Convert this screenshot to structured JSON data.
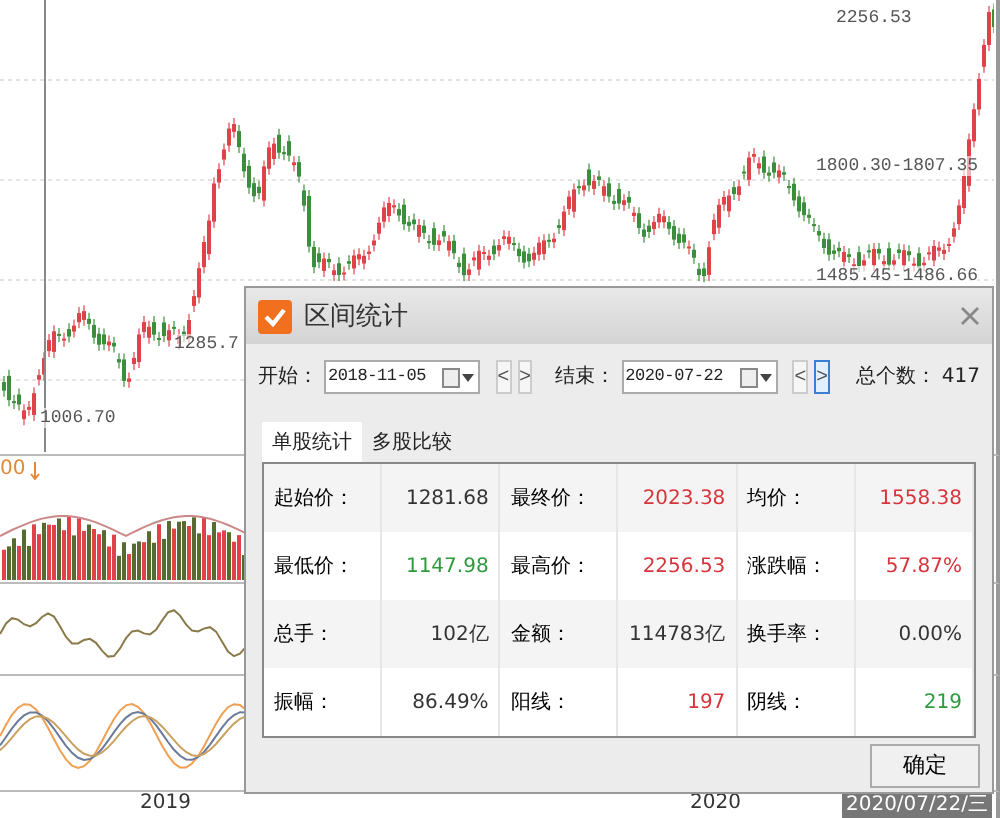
{
  "chart": {
    "price_marks": [
      {
        "kind": "high",
        "text": "2256.53"
      },
      {
        "kind": "upper",
        "text": "1800.30-1807.35"
      },
      {
        "kind": "lower",
        "text": "1485.45-1486.66"
      },
      {
        "kind": "mid",
        "text": "1285.7"
      },
      {
        "kind": "low",
        "text": "1006.70"
      }
    ],
    "volume_label": "00",
    "x_axis": [
      "2019",
      "2020"
    ],
    "cursor_date": "2020/07/22/三"
  },
  "dialog": {
    "title": "区间统计",
    "start": {
      "label": "开始：",
      "value": "2018-11-05",
      "nav": [
        {
          "label": "<",
          "selected": false
        },
        {
          "label": ">",
          "selected": false
        }
      ]
    },
    "end": {
      "label": "结束：",
      "value": "2020-07-22",
      "nav": [
        {
          "label": "<",
          "selected": false
        },
        {
          "label": ">",
          "selected": true
        }
      ]
    },
    "total": {
      "label": "总个数：",
      "value": "417"
    },
    "tabs": [
      {
        "label": "单股统计",
        "selected": true
      },
      {
        "label": "多股比较",
        "selected": false
      }
    ],
    "stats": [
      [
        {
          "label": "起始价：",
          "value": "1281.68",
          "color": "#333333"
        },
        {
          "label": "最终价：",
          "value": "2023.38",
          "color": "#d8343c"
        },
        {
          "label": "均价：",
          "value": "1558.38",
          "color": "#d8343c"
        }
      ],
      [
        {
          "label": "最低价：",
          "value": "1147.98",
          "color": "#2e9a3c"
        },
        {
          "label": "最高价：",
          "value": "2256.53",
          "color": "#d8343c"
        },
        {
          "label": "涨跌幅：",
          "value": "57.87%",
          "color": "#d8343c"
        }
      ],
      [
        {
          "label": "总手：",
          "value": "102亿",
          "color": "#333333"
        },
        {
          "label": "金额：",
          "value": "114783亿",
          "color": "#333333"
        },
        {
          "label": "换手率：",
          "value": "0.00%",
          "color": "#333333"
        }
      ],
      [
        {
          "label": "振幅：",
          "value": "86.49%",
          "color": "#333333"
        },
        {
          "label": "阳线：",
          "value": "197",
          "color": "#d8343c"
        },
        {
          "label": "阴线：",
          "value": "219",
          "color": "#2e9a3c"
        }
      ]
    ],
    "ok_button": "确定"
  }
}
